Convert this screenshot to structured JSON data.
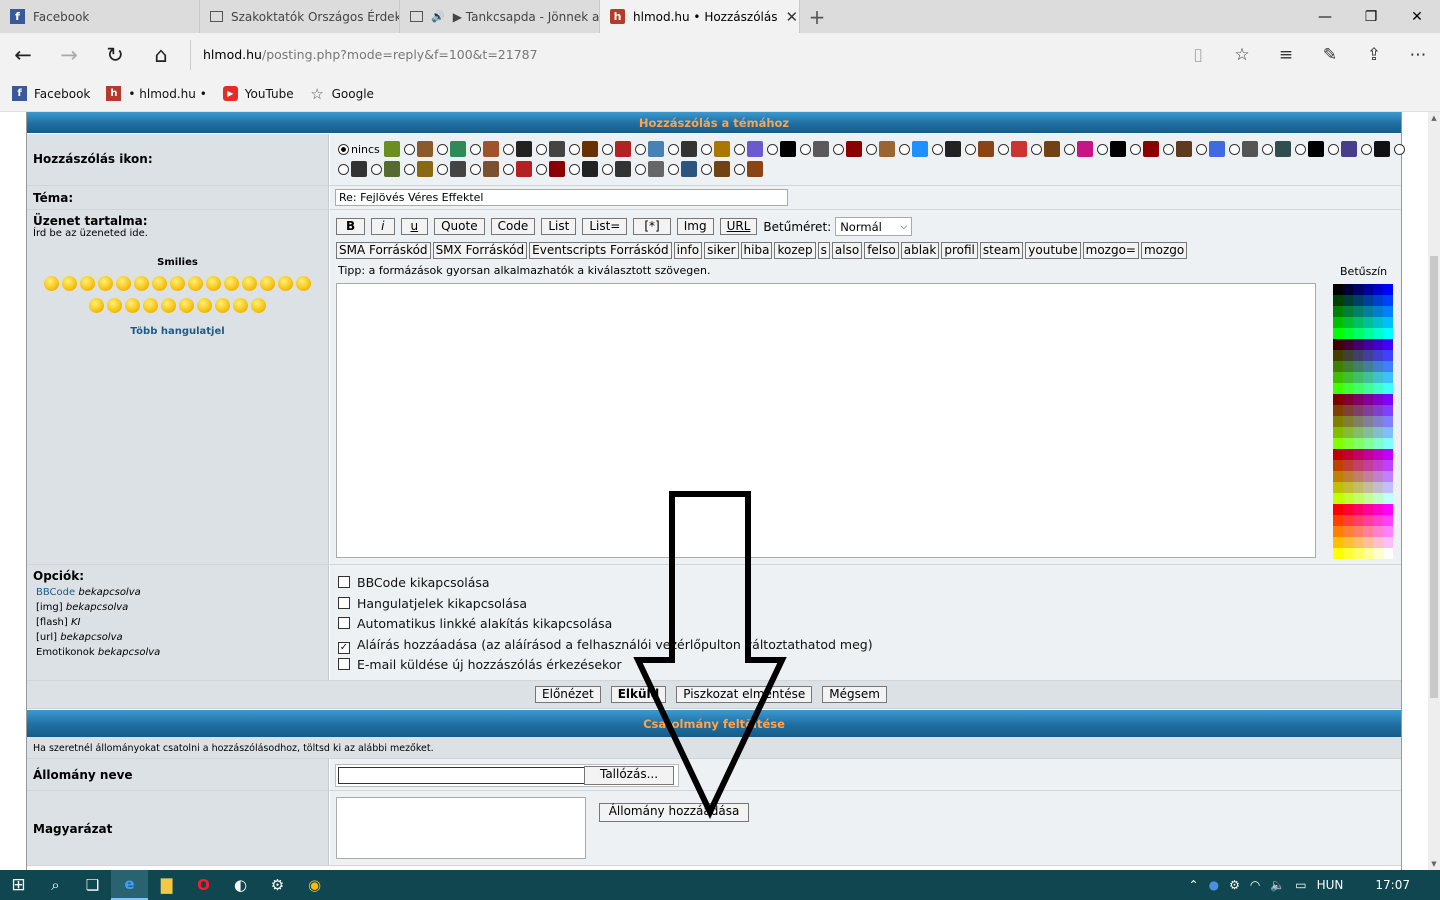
{
  "browser": {
    "tabs": [
      {
        "title": "Facebook",
        "icon": "facebook-icon",
        "color": "#3b5998",
        "active": false
      },
      {
        "title": "Szakoktatók Országos Érdekl",
        "icon": "window-icon",
        "color": "#555555",
        "active": false
      },
      {
        "title": "▶ Tankcsapda - Jönnek a",
        "icon": "speaker-icon",
        "color": "#555555",
        "active": false
      },
      {
        "title": "hlmod.hu • Hozzászólás",
        "icon": "hlmod-icon",
        "color": "#b23b2b",
        "active": true
      }
    ],
    "url_domain": "hlmod.hu",
    "url_path": "/posting.php?mode=reply&f=100&t=21787",
    "favorites": [
      {
        "label": "Facebook",
        "icon": "facebook-icon",
        "color": "#3b5998"
      },
      {
        "label": "• hlmod.hu •",
        "icon": "hlmod-icon",
        "color": "#b23b2b"
      },
      {
        "label": "YouTube",
        "icon": "youtube-icon",
        "color": "#e52d27"
      },
      {
        "label": "Google",
        "icon": "star-outline-icon",
        "color": "#555555"
      }
    ]
  },
  "form": {
    "section_title": "Hozzászólás a témához",
    "icon_label": "Hozzászólás ikon:",
    "icon_none": "nincs",
    "topic_label": "Téma:",
    "topic_value": "Re: Fejlövés Véres Effektel",
    "message_label": "Üzenet tartalma:",
    "message_hint": "Írd be az üzeneted ide.",
    "smilies_title": "Smilies",
    "more_smilies": "Több hangulatjel",
    "format_buttons": [
      "B",
      "i",
      "u",
      "Quote",
      "Code",
      "List",
      "List=",
      "[*]",
      "Img",
      "URL"
    ],
    "font_size_label": "Betűméret:",
    "font_size_value": "Normál",
    "custom_buttons": [
      "SMA Forráskód",
      "SMX Forráskód",
      "Eventscripts Forráskód",
      "info",
      "siker",
      "hiba",
      "kozep",
      "s",
      "also",
      "felso",
      "ablak",
      "profil",
      "steam",
      "youtube",
      "mozgo=",
      "mozgo"
    ],
    "tip": "Tipp: a formázások gyorsan alkalmazhatók a kiválasztott szövegen.",
    "font_color_label": "Betűszín",
    "options_label": "Opciók:",
    "options_status": [
      {
        "name": "BBCode",
        "value": "bekapcsolva",
        "link": true
      },
      {
        "name": "[img]",
        "value": "bekapcsolva",
        "link": false
      },
      {
        "name": "[flash]",
        "value": "KI",
        "link": false
      },
      {
        "name": "[url]",
        "value": "bekapcsolva",
        "link": false
      },
      {
        "name": "Emotikonok",
        "value": "bekapcsolva",
        "link": false
      }
    ],
    "checkboxes": [
      {
        "label": "BBCode kikapcsolása",
        "checked": false
      },
      {
        "label": "Hangulatjelek kikapcsolása",
        "checked": false
      },
      {
        "label": "Automatikus linkké alakítás kikapcsolása",
        "checked": false
      },
      {
        "label": "Aláírás hozzáadása (az aláírásod a felhasználói vezérlőpulton változtathatod meg)",
        "checked": true
      },
      {
        "label": "E-mail küldése új hozzászólás érkezésekor",
        "checked": false
      }
    ],
    "submit_buttons": [
      "Előnézet",
      "Elküld",
      "Piszkozat elmentése",
      "Mégsem"
    ]
  },
  "attachments": {
    "section_title": "Csatolmány feltöltése",
    "info": "Ha szeretnél állományokat csatolni a hozzászólásodhoz, töltsd ki az alábbi mezőket.",
    "filename_label": "Állomány neve",
    "browse_button": "Tallózás...",
    "comment_label": "Magyarázat",
    "add_button": "Állomány hozzáadása"
  },
  "taskbar": {
    "language": "HUN",
    "time": "17:07"
  },
  "colors": {
    "accent": "#1f6ea1",
    "header_text": "#ffa34f",
    "link": "#1b5c8c"
  }
}
